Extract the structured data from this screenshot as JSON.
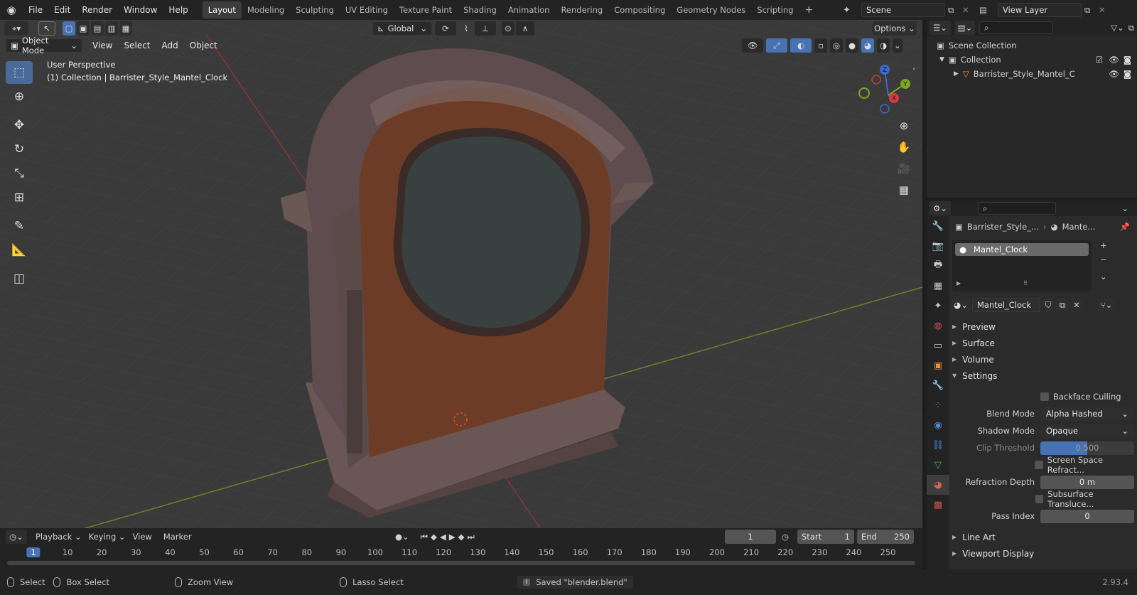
{
  "topbar": {
    "menus": [
      "File",
      "Edit",
      "Render",
      "Window",
      "Help"
    ],
    "workspaces": [
      "Layout",
      "Modeling",
      "Sculpting",
      "UV Editing",
      "Texture Paint",
      "Shading",
      "Animation",
      "Rendering",
      "Compositing",
      "Geometry Nodes",
      "Scripting"
    ],
    "active_workspace": "Layout",
    "scene": "Scene",
    "view_layer": "View Layer"
  },
  "viewport": {
    "mode": "Object Mode",
    "menus": [
      "View",
      "Select",
      "Add",
      "Object"
    ],
    "orientation": "Global",
    "options_label": "Options",
    "perspective_label": "User Perspective",
    "collection_label": "(1) Collection | Barrister_Style_Mantel_Clock",
    "gizmo": {
      "z": "Z",
      "y": "Y",
      "x": "X"
    }
  },
  "outliner": {
    "scene_collection": "Scene Collection",
    "collection": "Collection",
    "object": "Barrister_Style_Mantel_C"
  },
  "properties": {
    "breadcrumb_object": "Barrister_Style_...",
    "breadcrumb_material": "Mante...",
    "slot_name": "Mantel_Clock",
    "material_name": "Mantel_Clock",
    "panels": {
      "preview": "Preview",
      "surface": "Surface",
      "volume": "Volume",
      "settings": "Settings",
      "line_art": "Line Art",
      "viewport_display": "Viewport Display"
    },
    "settings": {
      "backface_culling": "Backface Culling",
      "blend_mode_label": "Blend Mode",
      "blend_mode": "Alpha Hashed",
      "shadow_mode_label": "Shadow Mode",
      "shadow_mode": "Opaque",
      "clip_threshold_label": "Clip Threshold",
      "clip_threshold": "0.500",
      "ssr": "Screen Space Refract...",
      "refraction_depth_label": "Refraction Depth",
      "refraction_depth": "0 m",
      "subsurface": "Subsurface Transluce...",
      "pass_index_label": "Pass Index",
      "pass_index": "0"
    }
  },
  "timeline": {
    "menus": [
      "Playback",
      "Keying",
      "View",
      "Marker"
    ],
    "current_frame": "1",
    "start_label": "Start",
    "start": "1",
    "end_label": "End",
    "end": "250",
    "ticks": [
      "1",
      "10",
      "20",
      "30",
      "40",
      "50",
      "60",
      "70",
      "80",
      "90",
      "100",
      "110",
      "120",
      "130",
      "140",
      "150",
      "160",
      "170",
      "180",
      "190",
      "200",
      "210",
      "220",
      "230",
      "240",
      "250"
    ]
  },
  "statusbar": {
    "select": "Select",
    "box_select": "Box Select",
    "zoom_view": "Zoom View",
    "lasso_select": "Lasso Select",
    "message": "Saved \"blender.blend\"",
    "version": "2.93.4"
  },
  "colors": {
    "accent": "#4772b3",
    "grid_red": "#9a3a3a",
    "grid_green": "#6a8a2a",
    "wood": "#6a3e28",
    "frame": "#6e5a58"
  }
}
